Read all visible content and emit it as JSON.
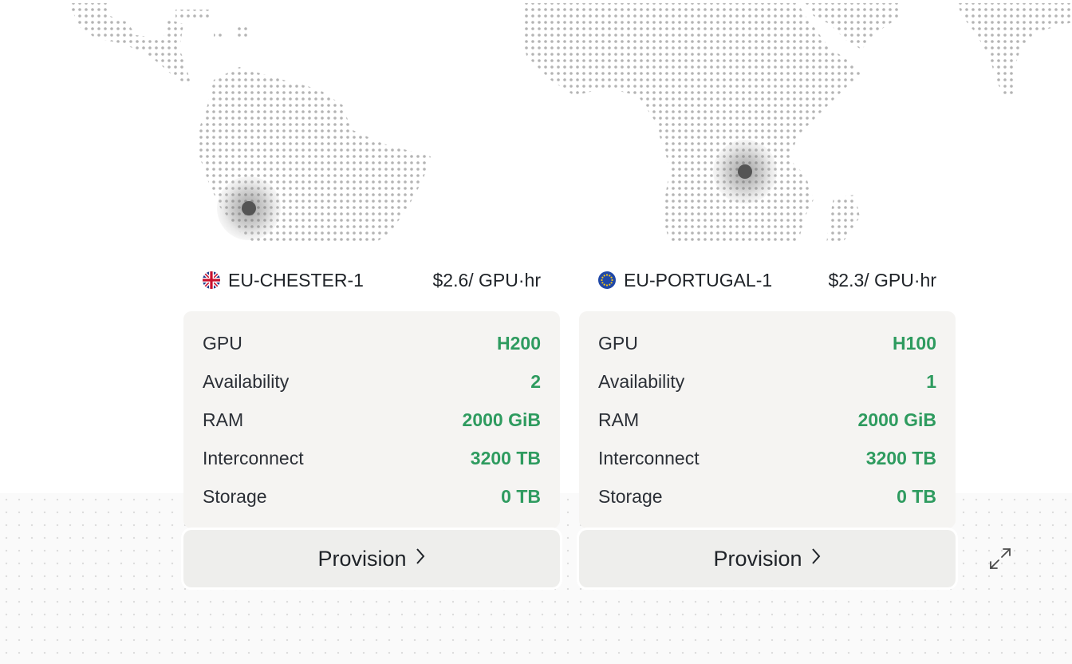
{
  "regions": [
    {
      "name": "EU-CHESTER-1",
      "price": "$2.6/ GPU·hr",
      "flag_icon": "uk-flag-icon",
      "specs": [
        {
          "label": "GPU",
          "value": "H200"
        },
        {
          "label": "Availability",
          "value": "2"
        },
        {
          "label": "RAM",
          "value": "2000 GiB"
        },
        {
          "label": "Interconnect",
          "value": "3200 TB"
        },
        {
          "label": "Storage",
          "value": "0 TB"
        }
      ],
      "provision_label": "Provision"
    },
    {
      "name": "EU-PORTUGAL-1",
      "price": "$2.3/ GPU·hr",
      "flag_icon": "eu-flag-icon",
      "specs": [
        {
          "label": "GPU",
          "value": "H100"
        },
        {
          "label": "Availability",
          "value": "1"
        },
        {
          "label": "RAM",
          "value": "2000 GiB"
        },
        {
          "label": "Interconnect",
          "value": "3200 TB"
        },
        {
          "label": "Storage",
          "value": "0 TB"
        }
      ],
      "provision_label": "Provision"
    }
  ],
  "icons": {
    "expand": "expand-arrows-icon",
    "chevron": "chevron-right-icon"
  },
  "colors": {
    "accent_green": "#2e9b5f",
    "card_bg": "#f5f4f2",
    "button_bg": "#eeeeec",
    "map_dot": "#b4b4b4"
  }
}
